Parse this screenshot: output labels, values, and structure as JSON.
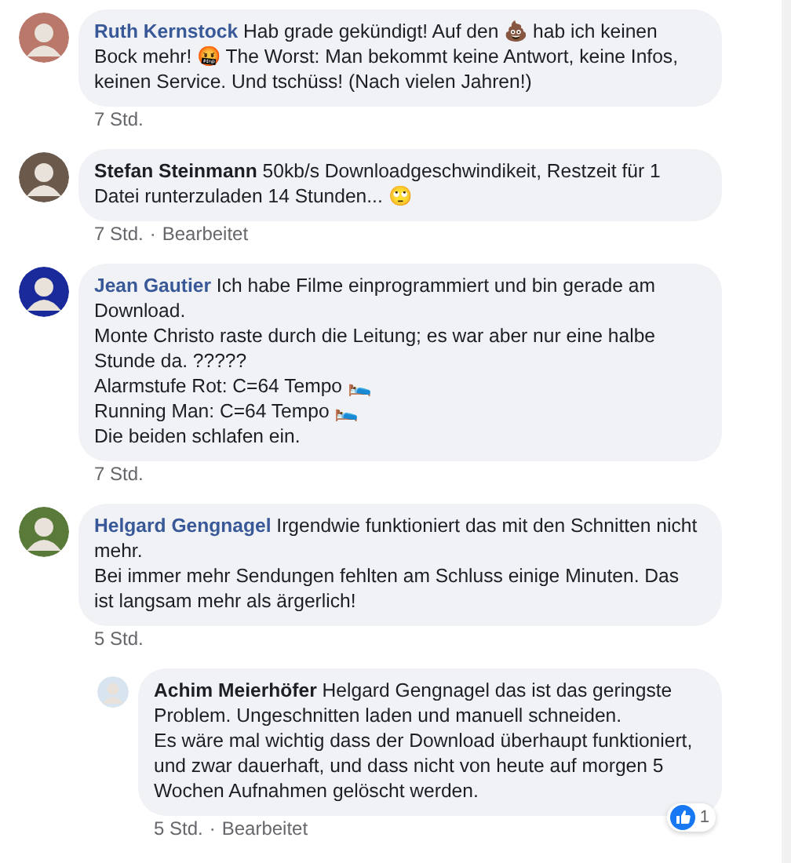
{
  "comments": [
    {
      "author": "Ruth Kernstock",
      "color": "#385898",
      "text": "Hab grade gekündigt! Auf den 💩 hab ich keinen Bock mehr! 🤬 The Worst: Man bekommt keine Antwort, keine Infos, keinen Service. Und tschüss! (Nach vielen Jahren!)",
      "time": "7 Std."
    },
    {
      "author": "Stefan Steinmann",
      "color": "#1c1e21",
      "text": "50kb/s Downloadgeschwindikeit, Restzeit für 1 Datei runterzuladen 14 Stunden... 🙄",
      "time": "7 Std.",
      "separator": "·",
      "note": "Bearbeitet"
    },
    {
      "author": "Jean Gautier",
      "color": "#385898",
      "text": "Ich habe Filme einprogrammiert und bin gerade am Download.\nMonte Christo raste durch die Leitung; es war aber nur eine halbe Stunde da. ?????\nAlarmstufe Rot: C=64 Tempo 🛌\nRunning Man: C=64 Tempo 🛌\nDie beiden schlafen ein.",
      "time": "7 Std."
    },
    {
      "author": "Helgard Gengnagel",
      "color": "#385898",
      "text": "Irgendwie funktioniert das mit den Schnitten nicht mehr.\nBei immer mehr Sendungen fehlten am Schluss einige Minuten. Das ist langsam mehr als ärgerlich!",
      "time": "5 Std.",
      "replies": [
        {
          "author": "Achim Meierhöfer",
          "color": "#1c1e21",
          "text": "Helgard Gengnagel das ist das geringste Problem. Ungeschnitten laden und manuell schneiden.\nEs wäre mal wichtig dass der Download überhaupt funktioniert, und zwar dauerhaft, und dass nicht von heute auf morgen 5 Wochen Aufnahmen gelöscht werden.",
          "time": "5 Std.",
          "separator": "·",
          "note": "Bearbeitet",
          "reactions": "1"
        }
      ]
    }
  ]
}
